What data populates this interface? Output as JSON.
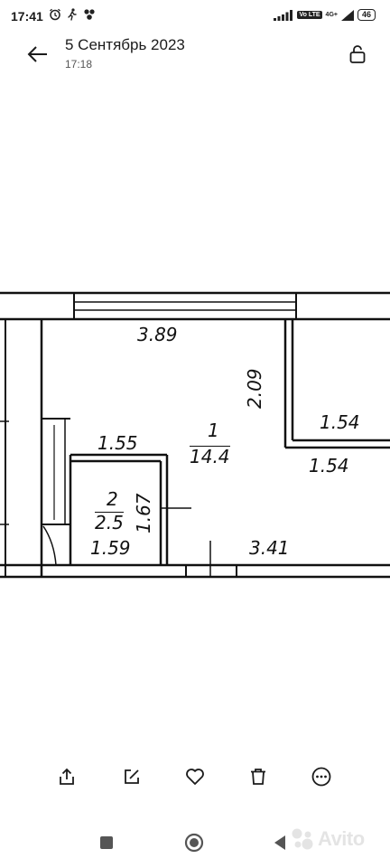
{
  "status_bar": {
    "time": "17:41",
    "network": "4G+",
    "volte": "Vo LTE",
    "battery": "46"
  },
  "header": {
    "title": "5 Сентябрь 2023",
    "subtitle": "17:18"
  },
  "floor_plan": {
    "labels": {
      "top_width": "3.89",
      "right_height": "2.09",
      "closet_top": "1.54",
      "closet_bottom": "1.54",
      "bath_top": "1.55",
      "room1_number": "1",
      "room1_area": "14.4",
      "room2_number": "2",
      "room2_area": "2.5",
      "bath_height": "1.67",
      "bath_bottom": "1.59",
      "bottom_width": "3.41"
    }
  },
  "toolbar": {
    "icons": [
      "share-icon",
      "edit-icon",
      "heart-icon",
      "trash-icon",
      "more-icon"
    ]
  },
  "watermark": {
    "text": "Avito"
  },
  "colors": {
    "background": "#ffffff",
    "image_bg": "#ececec",
    "text": "#1b1b1b",
    "plan_line": "#111111"
  }
}
